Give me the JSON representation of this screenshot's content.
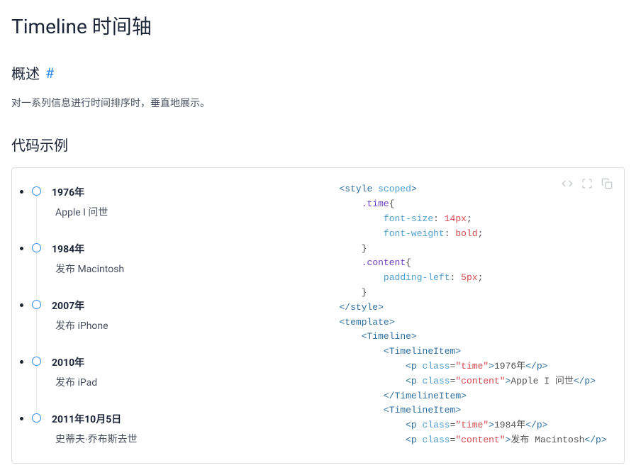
{
  "title": "Timeline 时间轴",
  "overview": {
    "heading": "概述",
    "anchor": "#",
    "text": "对一系列信息进行时间排序时，垂直地展示。"
  },
  "codeExample": {
    "heading": "代码示例"
  },
  "timeline": [
    {
      "time": "1976年",
      "content": "Apple I 问世"
    },
    {
      "time": "1984年",
      "content": "发布 Macintosh"
    },
    {
      "time": "2007年",
      "content": "发布 iPhone"
    },
    {
      "time": "2010年",
      "content": "发布 iPad"
    },
    {
      "time": "2011年10月5日",
      "content": "史蒂夫·乔布斯去世"
    }
  ],
  "code": {
    "style_open": "<style scoped>",
    "sel_time": ".time{",
    "prop_fontsize": "font-size",
    "val_fontsize": "14px",
    "prop_fontweight": "font-weight",
    "val_fontweight": "bold",
    "close_brace": "}",
    "sel_content": ".content{",
    "prop_paddingleft": "padding-left",
    "val_paddingleft": "5px",
    "style_close": "</style>",
    "template_open": "<template>",
    "timeline_open": "<Timeline>",
    "timelineitem_open": "<TimelineItem>",
    "timelineitem_close": "</TimelineItem>",
    "p_open": "<p",
    "p_close": "</p>",
    "class_attr": "class",
    "class_time": "\"time\"",
    "class_content": "\"content\"",
    "text_1976": "1976年",
    "text_apple1": "Apple I 问世",
    "text_1984": "1984年",
    "text_macintosh": "发布 Macintosh"
  }
}
